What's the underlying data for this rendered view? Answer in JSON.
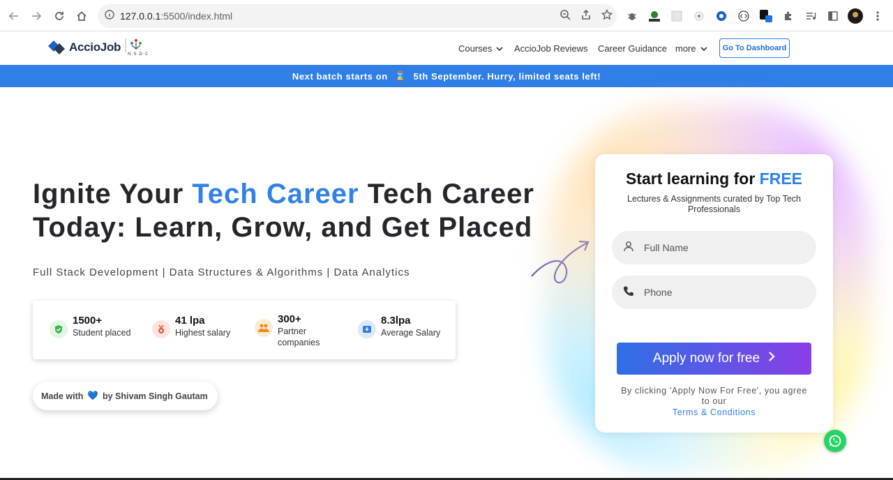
{
  "browser": {
    "url_host": "127.0.0.1",
    "url_path": ":5500/index.html"
  },
  "nav": {
    "logo_text": "AccioJob",
    "nsdc_text": "N·S·D·C",
    "items": [
      {
        "label": "Courses",
        "has_dropdown": true
      },
      {
        "label": "AccioJob Reviews",
        "has_dropdown": false
      },
      {
        "label": "Career Guidance",
        "has_dropdown": false
      },
      {
        "label": "more",
        "has_dropdown": true
      }
    ],
    "dashboard_button": "Go To Dashboard"
  },
  "banner": {
    "before": "Next batch starts on",
    "icon": "⌛",
    "after": "5th September. Hurry, limited seats left!"
  },
  "hero": {
    "title_part1": "Ignite Your ",
    "title_highlight": "Tech Career",
    "title_part2": " Tech Career Today: Learn, Grow, and Get Placed",
    "subtitle": "Full Stack Development | Data Structures & Algorithms | Data Analytics"
  },
  "stats": [
    {
      "value": "1500+",
      "label": "Student placed",
      "icon": "shield-check-icon",
      "color": "#3bb54a",
      "bg": "#e3f5e4"
    },
    {
      "value": "41 lpa",
      "label": "Highest salary",
      "icon": "medal-icon",
      "color": "#e5533c",
      "bg": "#fde4e0"
    },
    {
      "value": "300+",
      "label": "Partner companies",
      "icon": "users-icon",
      "color": "#f08a1c",
      "bg": "#fdebd6"
    },
    {
      "value": "8.3lpa",
      "label": "Average Salary",
      "icon": "inbox-icon",
      "color": "#2f7fe6",
      "bg": "#dde9fb"
    }
  ],
  "made_with": {
    "prefix": "Made with",
    "heart": "💙",
    "suffix": "by Shivam Singh Gautam"
  },
  "form": {
    "title_part1": "Start learning for ",
    "title_free": "FREE",
    "subtitle": "Lectures & Assignments curated by Top Tech Professionals",
    "name_placeholder": "Full Name",
    "phone_placeholder": "Phone",
    "apply_label": "Apply now for free",
    "agree_text": "By clicking 'Apply Now For Free', you agree to our",
    "terms_label": "Terms & Conditions"
  }
}
